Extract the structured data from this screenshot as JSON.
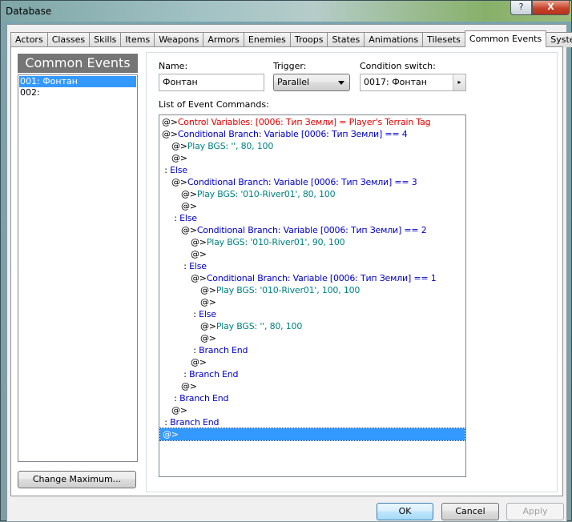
{
  "window": {
    "title": "Database",
    "help_label": "?",
    "close_label": "X"
  },
  "tabs": [
    {
      "label": "Actors"
    },
    {
      "label": "Classes"
    },
    {
      "label": "Skills"
    },
    {
      "label": "Items"
    },
    {
      "label": "Weapons"
    },
    {
      "label": "Armors"
    },
    {
      "label": "Enemies"
    },
    {
      "label": "Troops"
    },
    {
      "label": "States"
    },
    {
      "label": "Animations"
    },
    {
      "label": "Tilesets"
    },
    {
      "label": "Common Events"
    },
    {
      "label": "System"
    }
  ],
  "active_tab": "Common Events",
  "left": {
    "header": "Common Events",
    "items": [
      {
        "label": "001: Фонтан",
        "selected": true
      },
      {
        "label": "002:",
        "selected": false
      }
    ],
    "change_max_label": "Change Maximum..."
  },
  "form": {
    "name_label": "Name:",
    "name_value": "Фонтан",
    "trigger_label": "Trigger:",
    "trigger_value": "Parallel",
    "condition_label": "Condition switch:",
    "condition_value": "0017: Фонтан",
    "condition_button": "▸",
    "list_label": "List of Event Commands:"
  },
  "commands": [
    {
      "prefix": "@>",
      "text": "Control Variables: [0006: Тип Земли] = Player's Terrain Tag",
      "color": "red",
      "indent": 0
    },
    {
      "prefix": "@>",
      "text": "Conditional Branch: Variable [0006: Тип Земли] == 4",
      "color": "blue",
      "indent": 0
    },
    {
      "prefix": "@>",
      "text": "Play BGS: '', 80, 100",
      "color": "teal",
      "indent": 1
    },
    {
      "prefix": "@>",
      "text": "",
      "color": "black",
      "indent": 1
    },
    {
      "prefix": " : ",
      "text": "Else",
      "color": "blue",
      "indent": 0
    },
    {
      "prefix": "@>",
      "text": "Conditional Branch: Variable [0006: Тип Земли] == 3",
      "color": "blue",
      "indent": 1
    },
    {
      "prefix": "@>",
      "text": "Play BGS: '010-River01', 80, 100",
      "color": "teal",
      "indent": 2
    },
    {
      "prefix": "@>",
      "text": "",
      "color": "black",
      "indent": 2
    },
    {
      "prefix": " : ",
      "text": "Else",
      "color": "blue",
      "indent": 1
    },
    {
      "prefix": "@>",
      "text": "Conditional Branch: Variable [0006: Тип Земли] == 2",
      "color": "blue",
      "indent": 2
    },
    {
      "prefix": "@>",
      "text": "Play BGS: '010-River01', 90, 100",
      "color": "teal",
      "indent": 3
    },
    {
      "prefix": "@>",
      "text": "",
      "color": "black",
      "indent": 3
    },
    {
      "prefix": " : ",
      "text": "Else",
      "color": "blue",
      "indent": 2
    },
    {
      "prefix": "@>",
      "text": "Conditional Branch: Variable [0006: Тип Земли] == 1",
      "color": "blue",
      "indent": 3
    },
    {
      "prefix": "@>",
      "text": "Play BGS: '010-River01', 100, 100",
      "color": "teal",
      "indent": 4
    },
    {
      "prefix": "@>",
      "text": "",
      "color": "black",
      "indent": 4
    },
    {
      "prefix": " : ",
      "text": "Else",
      "color": "blue",
      "indent": 3
    },
    {
      "prefix": "@>",
      "text": "Play BGS: '', 80, 100",
      "color": "teal",
      "indent": 4
    },
    {
      "prefix": "@>",
      "text": "",
      "color": "black",
      "indent": 4
    },
    {
      "prefix": " : ",
      "text": "Branch End",
      "color": "blue",
      "indent": 3
    },
    {
      "prefix": "@>",
      "text": "",
      "color": "black",
      "indent": 3
    },
    {
      "prefix": " : ",
      "text": "Branch End",
      "color": "blue",
      "indent": 2
    },
    {
      "prefix": "@>",
      "text": "",
      "color": "black",
      "indent": 2
    },
    {
      "prefix": " : ",
      "text": "Branch End",
      "color": "blue",
      "indent": 1
    },
    {
      "prefix": "@>",
      "text": "",
      "color": "black",
      "indent": 1
    },
    {
      "prefix": " : ",
      "text": "Branch End",
      "color": "blue",
      "indent": 0
    },
    {
      "prefix": "@>",
      "text": "",
      "color": "black",
      "indent": 0,
      "selected": true
    }
  ],
  "buttons": {
    "ok": "OK",
    "cancel": "Cancel",
    "apply": "Apply"
  },
  "colors": {
    "selection": "#3399ff",
    "header_bg": "#757575",
    "command_red": "#e00000",
    "command_blue": "#0000c8",
    "command_teal": "#008080"
  }
}
